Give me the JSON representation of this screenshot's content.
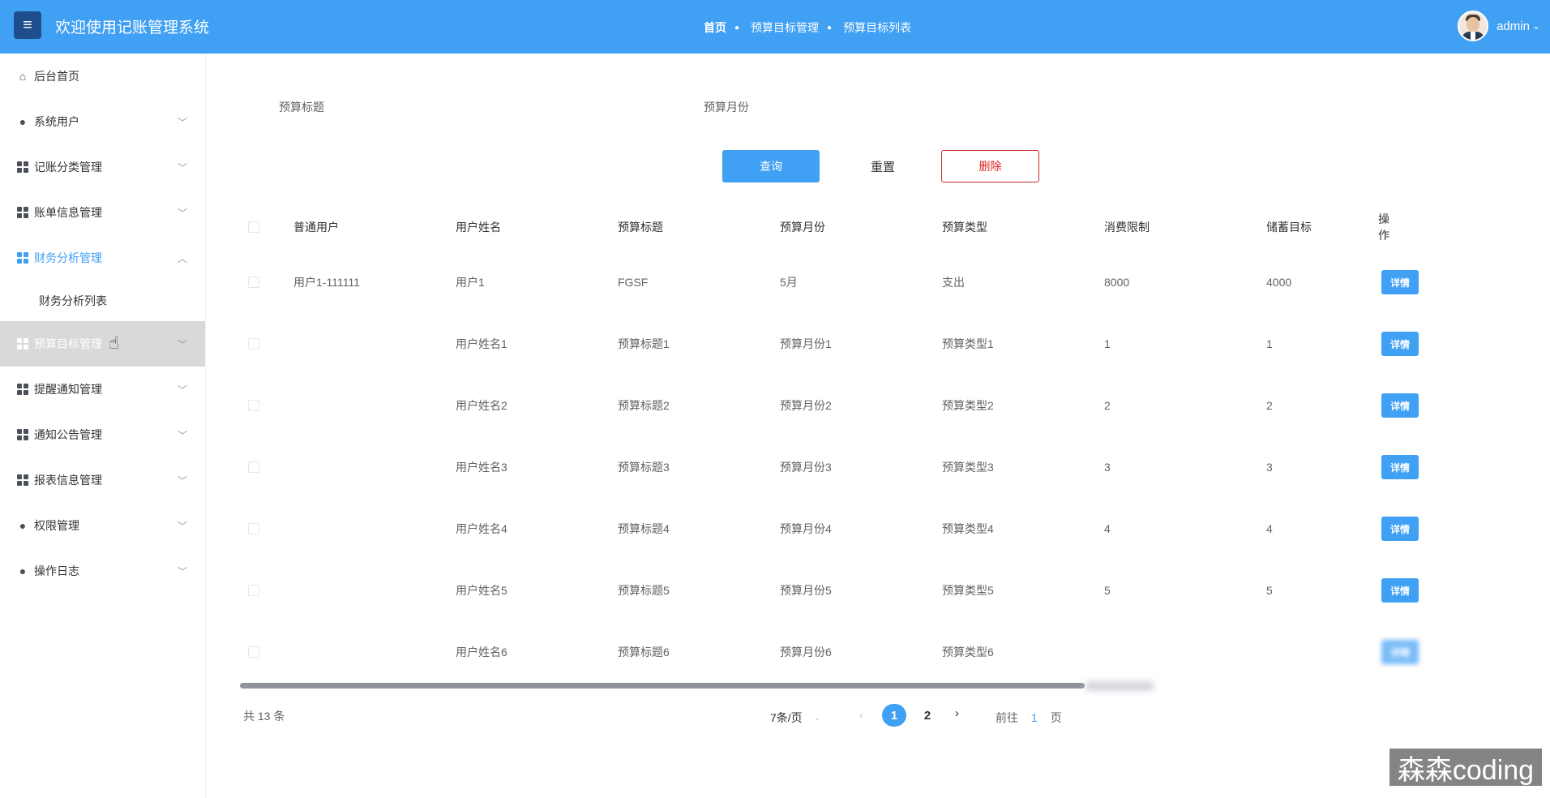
{
  "header": {
    "menu_icon": "hamburger-icon",
    "title": "欢迎使用记账管理系统",
    "breadcrumb": [
      "首页",
      "预算目标管理",
      "预算目标列表"
    ],
    "username": "admin",
    "caret": "⌄"
  },
  "sidebar": {
    "items": [
      {
        "label": "后台首页",
        "icon": "home-icon"
      },
      {
        "label": "系统用户",
        "icon": "user-icon"
      },
      {
        "label": "记账分类管理",
        "icon": "grid-icon"
      },
      {
        "label": "账单信息管理",
        "icon": "grid-icon"
      },
      {
        "label": "财务分析管理",
        "icon": "grid-icon"
      },
      {
        "label": "财务分析列表",
        "icon": ""
      },
      {
        "label": "预算目标管理",
        "icon": "grid-icon"
      },
      {
        "label": "提醒通知管理",
        "icon": "grid-icon"
      },
      {
        "label": "通知公告管理",
        "icon": "grid-icon"
      },
      {
        "label": "报表信息管理",
        "icon": "grid-icon"
      },
      {
        "label": "权限管理",
        "icon": "user-icon"
      },
      {
        "label": "操作日志",
        "icon": "user-icon"
      }
    ]
  },
  "filters": {
    "title_label": "预算标题",
    "month_label": "预算月份"
  },
  "actions": {
    "query": "查询",
    "reset": "重置",
    "delete": "删除"
  },
  "table": {
    "columns": [
      "普通用户",
      "用户姓名",
      "预算标题",
      "预算月份",
      "预算类型",
      "消费限制",
      "储蓄目标",
      "操作"
    ],
    "detail_label": "详情",
    "rows": [
      [
        "用户1-111111",
        "用户1",
        "FGSF",
        "5月",
        "支出",
        "8000",
        "4000"
      ],
      [
        "",
        "用户姓名1",
        "预算标题1",
        "预算月份1",
        "预算类型1",
        "1",
        "1"
      ],
      [
        "",
        "用户姓名2",
        "预算标题2",
        "预算月份2",
        "预算类型2",
        "2",
        "2"
      ],
      [
        "",
        "用户姓名3",
        "预算标题3",
        "预算月份3",
        "预算类型3",
        "3",
        "3"
      ],
      [
        "",
        "用户姓名4",
        "预算标题4",
        "预算月份4",
        "预算类型4",
        "4",
        "4"
      ],
      [
        "",
        "用户姓名5",
        "预算标题5",
        "预算月份5",
        "预算类型5",
        "5",
        "5"
      ],
      [
        "",
        "用户姓名6",
        "预算标题6",
        "预算月份6",
        "预算类型6",
        "",
        ""
      ]
    ]
  },
  "pagination": {
    "total": "共 13 条",
    "page_size": "7条/页",
    "pages": [
      "1",
      "2"
    ],
    "goto_prefix": "前往",
    "goto_value": "1",
    "goto_suffix": "页"
  },
  "watermark": "森森coding",
  "colors": {
    "primary": "#3fa0f4",
    "danger": "#e02020",
    "nav_dark": "#1f4e8c"
  }
}
